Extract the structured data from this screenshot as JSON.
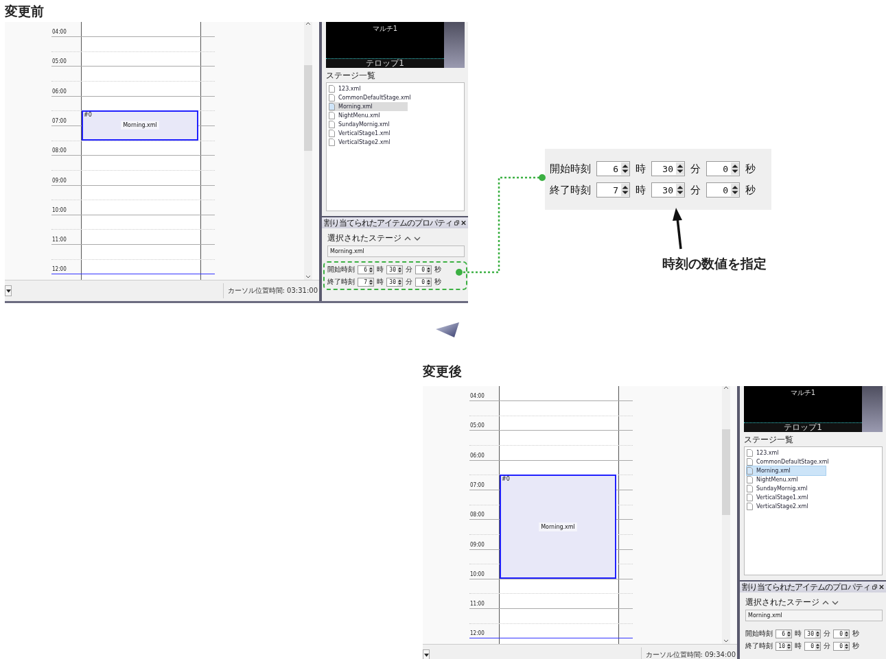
{
  "before": {
    "heading": "変更前",
    "screen": {
      "hours": [
        {
          "label": "04:00",
          "current": false
        },
        {
          "label": "05:00",
          "current": false
        },
        {
          "label": "06:00",
          "current": false
        },
        {
          "label": "07:00",
          "current": false
        },
        {
          "label": "08:00",
          "current": false
        },
        {
          "label": "09:00",
          "current": false
        },
        {
          "label": "10:00",
          "current": false
        },
        {
          "label": "11:00",
          "current": false
        },
        {
          "label": "12:00",
          "current": true
        }
      ],
      "event": {
        "index": "#0",
        "label": "Morning.xml"
      },
      "status": "カーソル位置時間: 03:31:00",
      "preview": {
        "top_label": "マルチ1",
        "bottom_label": "テロップ1"
      },
      "stage_list": {
        "title": "ステージ一覧",
        "focused": false,
        "items": [
          {
            "name": "123.xml",
            "selected": false
          },
          {
            "name": "CommonDefaultStage.xml",
            "selected": false
          },
          {
            "name": "Morning.xml",
            "selected": true
          },
          {
            "name": "NightMenu.xml",
            "selected": false
          },
          {
            "name": "SundayMornig.xml",
            "selected": false
          },
          {
            "name": "VerticalStage1.xml",
            "selected": false
          },
          {
            "name": "VerticalStage2.xml",
            "selected": false
          }
        ]
      },
      "properties": {
        "title": "割り当てられたアイテムのプロパティ",
        "stage_label": "選択されたステージ",
        "stage_value": "Morning.xml",
        "highlighted": true,
        "time_rows": [
          {
            "label": "開始時刻",
            "fields": [
              {
                "value": "6",
                "unit": "時"
              },
              {
                "value": "30",
                "unit": "分"
              },
              {
                "value": "0",
                "unit": "秒"
              }
            ]
          },
          {
            "label": "終了時刻",
            "fields": [
              {
                "value": "7",
                "unit": "時"
              },
              {
                "value": "30",
                "unit": "分"
              },
              {
                "value": "0",
                "unit": "秒"
              }
            ]
          }
        ]
      }
    }
  },
  "callout": {
    "time_rows": [
      {
        "label": "開始時刻",
        "fields": [
          {
            "value": "6",
            "unit": "時"
          },
          {
            "value": "30",
            "unit": "分"
          },
          {
            "value": "0",
            "unit": "秒"
          }
        ]
      },
      {
        "label": "終了時刻",
        "fields": [
          {
            "value": "7",
            "unit": "時"
          },
          {
            "value": "30",
            "unit": "分"
          },
          {
            "value": "0",
            "unit": "秒"
          }
        ]
      }
    ],
    "caption": "時刻の数値を指定"
  },
  "after": {
    "heading": "変更後",
    "screen": {
      "hours": [
        {
          "label": "04:00",
          "current": false
        },
        {
          "label": "05:00",
          "current": false
        },
        {
          "label": "06:00",
          "current": false
        },
        {
          "label": "07:00",
          "current": false
        },
        {
          "label": "08:00",
          "current": false
        },
        {
          "label": "09:00",
          "current": false
        },
        {
          "label": "10:00",
          "current": false
        },
        {
          "label": "11:00",
          "current": false
        },
        {
          "label": "12:00",
          "current": true
        }
      ],
      "event": {
        "index": "#0",
        "label": "Morning.xml"
      },
      "status": "カーソル位置時間: 09:34:00",
      "preview": {
        "top_label": "マルチ1",
        "bottom_label": "テロップ1"
      },
      "stage_list": {
        "title": "ステージ一覧",
        "focused": true,
        "items": [
          {
            "name": "123.xml",
            "selected": false
          },
          {
            "name": "CommonDefaultStage.xml",
            "selected": false
          },
          {
            "name": "Morning.xml",
            "selected": true
          },
          {
            "name": "NightMenu.xml",
            "selected": false
          },
          {
            "name": "SundayMornig.xml",
            "selected": false
          },
          {
            "name": "VerticalStage1.xml",
            "selected": false
          },
          {
            "name": "VerticalStage2.xml",
            "selected": false
          }
        ]
      },
      "properties": {
        "title": "割り当てられたアイテムのプロパティ",
        "stage_label": "選択されたステージ",
        "stage_value": "Morning.xml",
        "highlighted": false,
        "time_rows": [
          {
            "label": "開始時刻",
            "fields": [
              {
                "value": "6",
                "unit": "時"
              },
              {
                "value": "30",
                "unit": "分"
              },
              {
                "value": "0",
                "unit": "秒"
              }
            ]
          },
          {
            "label": "終了時刻",
            "fields": [
              {
                "value": "10",
                "unit": "時"
              },
              {
                "value": "0",
                "unit": "分"
              },
              {
                "value": "0",
                "unit": "秒"
              }
            ]
          }
        ]
      }
    }
  }
}
